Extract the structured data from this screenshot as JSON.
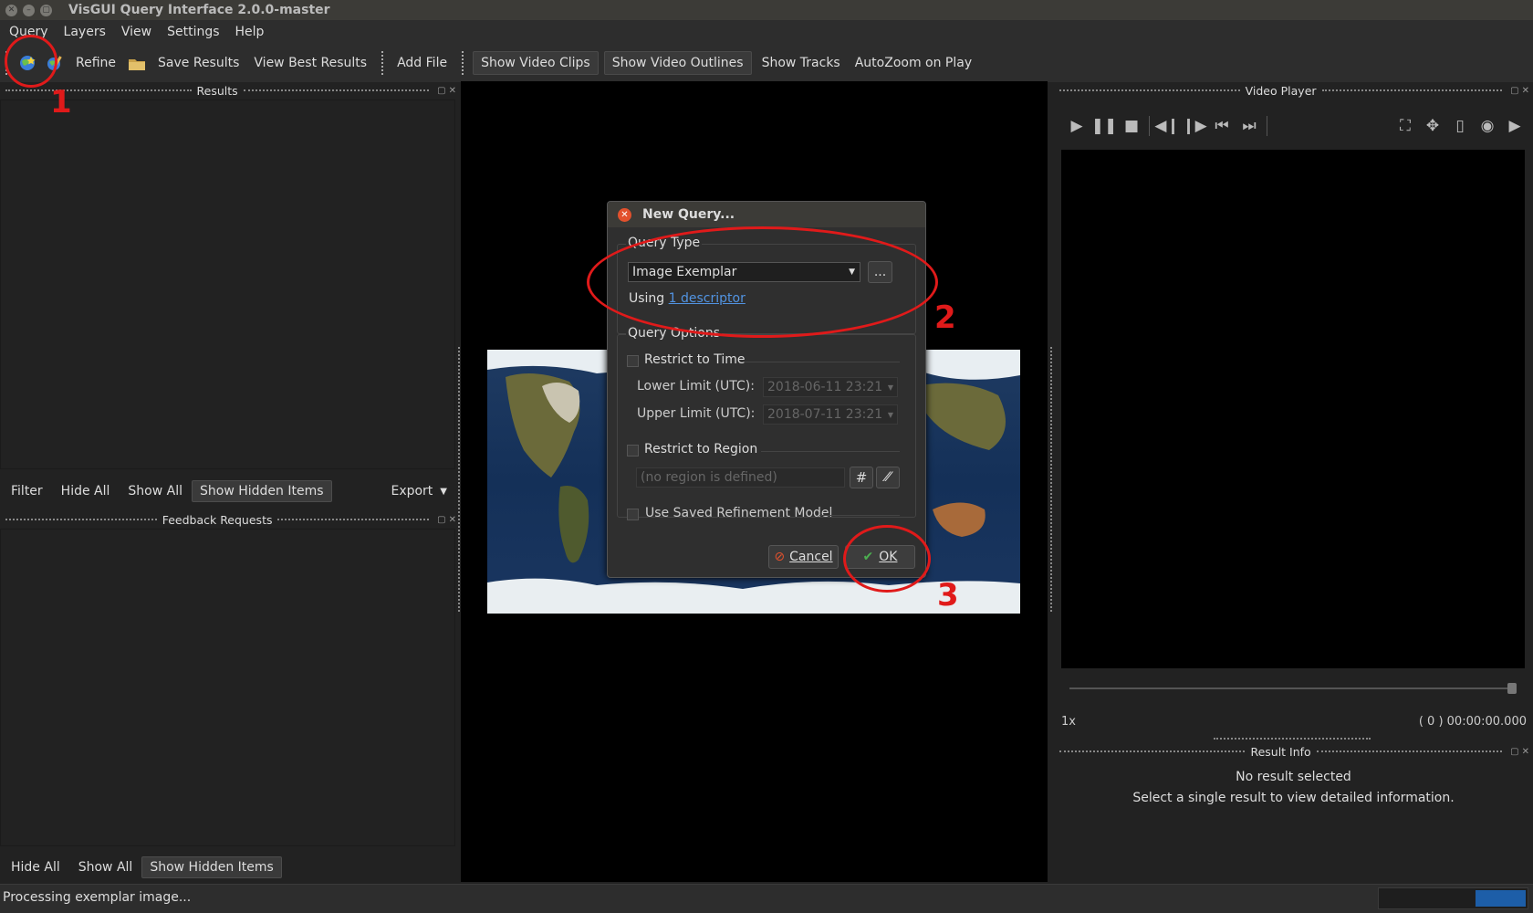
{
  "window": {
    "title": "VisGUI Query Interface 2.0.0-master"
  },
  "menu": [
    "Query",
    "Layers",
    "View",
    "Settings",
    "Help"
  ],
  "toolbar": {
    "refine": "Refine",
    "save_results": "Save Results",
    "view_best": "View Best Results",
    "add_file": "Add File",
    "show_video_clips": "Show Video Clips",
    "show_video_outlines": "Show Video Outlines",
    "show_tracks": "Show Tracks",
    "autozoom": "AutoZoom on Play"
  },
  "results_dock": {
    "title": "Results"
  },
  "results_actions": {
    "filter": "Filter",
    "hide_all": "Hide All",
    "show_all": "Show All",
    "show_hidden": "Show Hidden Items",
    "export": "Export"
  },
  "feedback_dock": {
    "title": "Feedback Requests"
  },
  "feedback_actions": {
    "hide_all": "Hide All",
    "show_all": "Show All",
    "show_hidden": "Show Hidden Items"
  },
  "video_dock": {
    "title": "Video Player",
    "speed": "1x",
    "time": "( 0 ) 00:00:00.000"
  },
  "result_info": {
    "title": "Result Info",
    "headline": "No result selected",
    "sub": "Select a single result to view detailed information."
  },
  "status": {
    "text": "Processing exemplar image..."
  },
  "dialog": {
    "title": "New Query...",
    "query_type_label": "Query Type",
    "query_type_value": "Image Exemplar",
    "more_button": "...",
    "using_prefix": "Using",
    "descriptor_link": "1 descriptor",
    "options_label": "Query Options",
    "restrict_time": "Restrict to Time",
    "lower_label": "Lower Limit (UTC):",
    "lower_value": "2018-06-11 23:21",
    "upper_label": "Upper Limit (UTC):",
    "upper_value": "2018-07-11 23:21",
    "restrict_region": "Restrict to Region",
    "region_placeholder": "(no region is defined)",
    "use_saved_model": "Use Saved Refinement Model",
    "cancel": "Cancel",
    "ok": "OK"
  },
  "annotations": [
    "1",
    "2",
    "3"
  ],
  "colors": {
    "annotation": "#e01a1a",
    "link": "#5294e2",
    "ok_check": "#4caf50",
    "status_progress": "#1d5ea8"
  }
}
